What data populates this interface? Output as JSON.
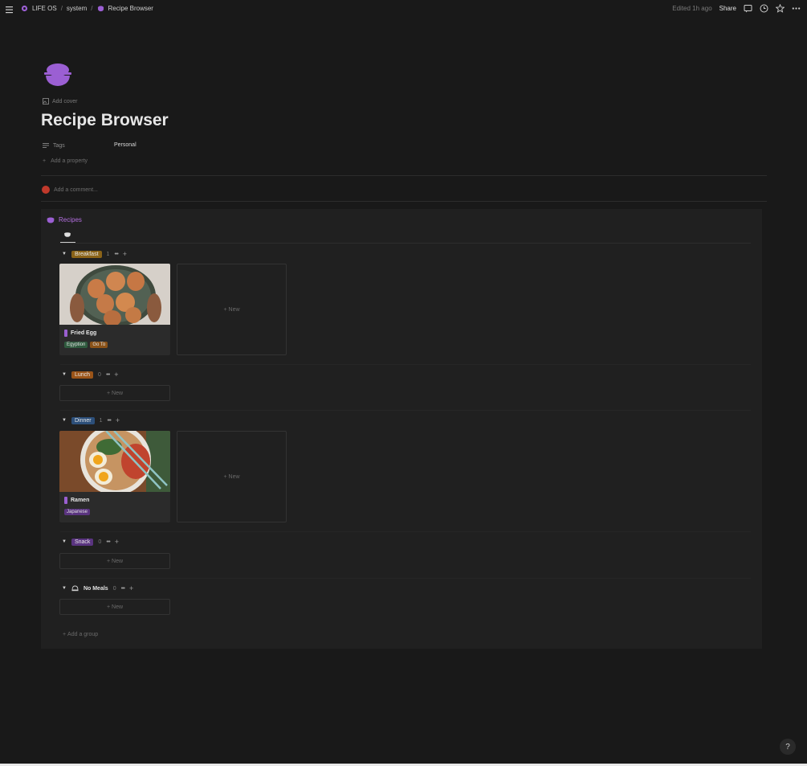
{
  "topbar": {
    "breadcrumbs": [
      "LIFE OS",
      "system",
      "Recipe Browser"
    ],
    "separator": "/",
    "edited": "Edited 1h ago",
    "share": "Share"
  },
  "page": {
    "add_cover": "Add cover",
    "title": "Recipe Browser",
    "property_name": "Tags",
    "property_value": "Personal",
    "add_property": "Add a property",
    "comment_placeholder": "Add a comment..."
  },
  "database": {
    "title": "Recipes",
    "groups": [
      {
        "name": "Breakfast",
        "count": "1",
        "color": "#8a6318"
      },
      {
        "name": "Lunch",
        "count": "0",
        "color": "#9a5418"
      },
      {
        "name": "Dinner",
        "count": "1",
        "color": "#2c4f7a"
      },
      {
        "name": "Snack",
        "count": "0",
        "color": "#5a3480"
      },
      {
        "name": "No Meals",
        "count": "0",
        "color": ""
      }
    ],
    "cards": [
      {
        "name": "Fried Egg",
        "tags": [
          {
            "label": "Egyption",
            "color": "#2f5a3e"
          },
          {
            "label": "Go To",
            "color": "#8a5218"
          }
        ]
      },
      {
        "name": "Ramen",
        "tags": [
          {
            "label": "Japanese",
            "color": "#5a3480"
          }
        ]
      }
    ],
    "new_label": "New",
    "add_group": "Add a group"
  },
  "help": "?"
}
